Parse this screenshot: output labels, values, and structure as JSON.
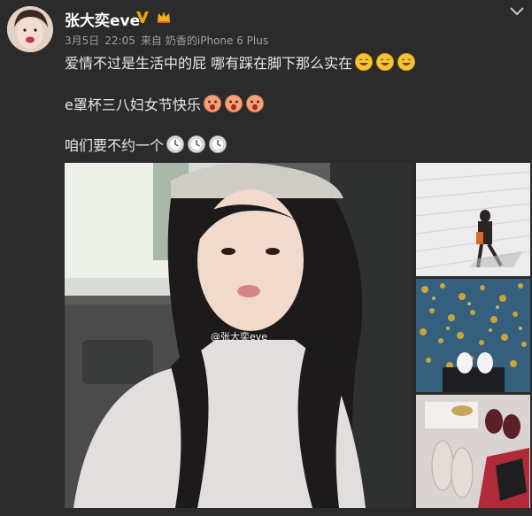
{
  "user": {
    "name": "张大奕eve",
    "verified_icon": "verified-v-icon",
    "vip_icon": "vip-crown-icon"
  },
  "meta": {
    "date": "3月5日",
    "time": "22:05",
    "source_prefix": "来自",
    "source": "奶香的iPhone 6 Plus"
  },
  "post": {
    "line1": "爱情不过是生活中的屁 哪有踩在脚下那么实在",
    "line1_emoji": "laughing-face-icon",
    "line2": "e罩杯三八妇女节快乐",
    "line2_emoji": "surprised-face-icon",
    "line3": "咱们要不约一个",
    "line3_emoji": "clock-icon"
  },
  "images": {
    "watermark": "@张大奕eve"
  },
  "colors": {
    "background": "#2b2b2b",
    "text": "#e8e8e8",
    "meta": "#a0a0a0",
    "verified": "#f0a000"
  }
}
